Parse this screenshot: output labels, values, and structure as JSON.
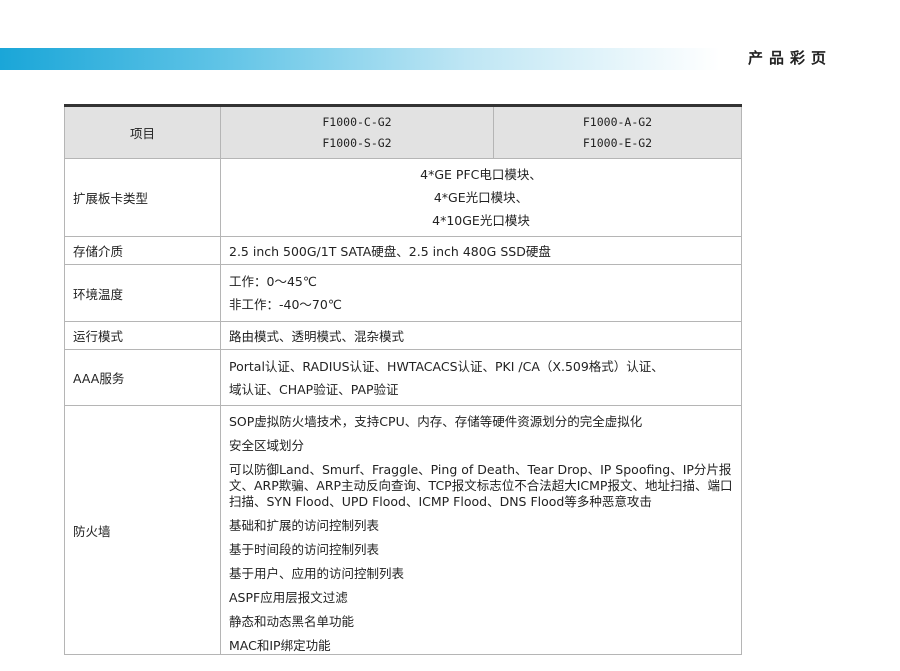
{
  "header": {
    "title": "产品彩页"
  },
  "table": {
    "head": {
      "label": "项目",
      "col_a_models": [
        "F1000-C-G2",
        "F1000-S-G2"
      ],
      "col_b_models": [
        "F1000-A-G2",
        "F1000-E-G2"
      ]
    },
    "rows": {
      "expansion": {
        "label": "扩展板卡类型",
        "lines": [
          "4*GE PFC电口模块、",
          "4*GE光口模块、",
          "4*10GE光口模块"
        ]
      },
      "storage": {
        "label": "存储介质",
        "value": "2.5 inch 500G/1T SATA硬盘、2.5 inch 480G SSD硬盘"
      },
      "temperature": {
        "label": "环境温度",
        "lines": [
          "工作：0～45℃",
          "非工作：-40～70℃"
        ]
      },
      "mode": {
        "label": "运行模式",
        "value": "路由模式、透明模式、混杂模式"
      },
      "aaa": {
        "label": "AAA服务",
        "lines": [
          "Portal认证、RADIUS认证、HWTACACS认证、PKI /CA（X.509格式）认证、",
          "域认证、CHAP验证、PAP验证"
        ]
      },
      "firewall": {
        "label": "防火墙",
        "items": [
          "SOP虚拟防火墙技术，支持CPU、内存、存储等硬件资源划分的完全虚拟化",
          "安全区域划分",
          "可以防御Land、Smurf、Fraggle、Ping of Death、Tear Drop、IP Spoofing、IP分片报文、ARP欺骗、ARP主动反向查询、TCP报文标志位不合法超大ICMP报文、地址扫描、端口扫描、SYN Flood、UPD Flood、ICMP Flood、DNS Flood等多种恶意攻击",
          "基础和扩展的访问控制列表",
          "基于时间段的访问控制列表",
          "基于用户、应用的访问控制列表",
          "ASPF应用层报文过滤",
          "静态和动态黑名单功能",
          "MAC和IP绑定功能"
        ]
      }
    }
  }
}
